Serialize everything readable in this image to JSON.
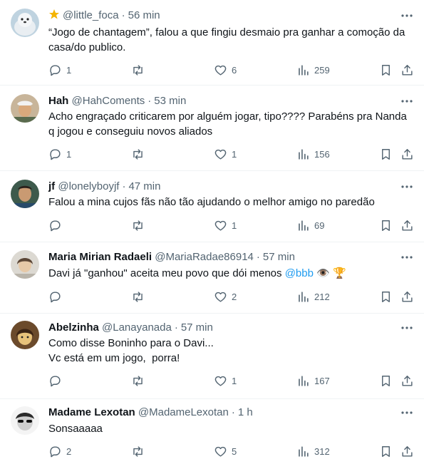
{
  "tweets": [
    {
      "name": "",
      "handle": "@little_foca",
      "time": "56 min",
      "text": [
        "“Jogo de chantagem”, falou a que fingiu desmaio pra ganhar a comoção da",
        "casa/do publico."
      ],
      "replies": "1",
      "retweets": "",
      "likes": "6",
      "views": "259"
    },
    {
      "name": "Hah",
      "handle": "@HahComents",
      "time": "53 min",
      "text": [
        "Acho engraçado criticarem por alguém jogar, tipo???? Parabéns pra Nanda",
        "q jogou e conseguiu novos aliados"
      ],
      "replies": "1",
      "retweets": "",
      "likes": "1",
      "views": "156"
    },
    {
      "name": "jf",
      "handle": "@lonelyboyjf",
      "time": "47 min",
      "text": [
        "Falou a mina cujos fãs não tão ajudando o melhor amigo no paredão"
      ],
      "replies": "",
      "retweets": "",
      "likes": "1",
      "views": "69"
    },
    {
      "name": "Maria Mirian Radaeli",
      "handle": "@MariaRadae86914",
      "time": "57 min",
      "text_prefix": "Davi já \"ganhou\" aceita meu povo que dói menos ",
      "mention": "@bbb",
      "emoji": "👁️ 🏆",
      "replies": "",
      "retweets": "",
      "likes": "2",
      "views": "212"
    },
    {
      "name": "Abelzinha",
      "handle": "@Lanayanada",
      "time": "57 min",
      "text": [
        "Como disse Boninho para o Davi...",
        "Vc está em um jogo,  porra!"
      ],
      "replies": "",
      "retweets": "",
      "likes": "1",
      "views": "167"
    },
    {
      "name": "Madame Lexotan",
      "handle": "@MadameLexotan",
      "time": "1 h",
      "text": [
        "Sonsaaaaa"
      ],
      "replies": "2",
      "retweets": "",
      "likes": "5",
      "views": "312"
    }
  ],
  "separator": "·",
  "colors": {
    "text": "#0f1419",
    "muted": "#536471",
    "link": "#1d9bf0",
    "badge": "#f4b400",
    "border": "#eff3f4"
  }
}
